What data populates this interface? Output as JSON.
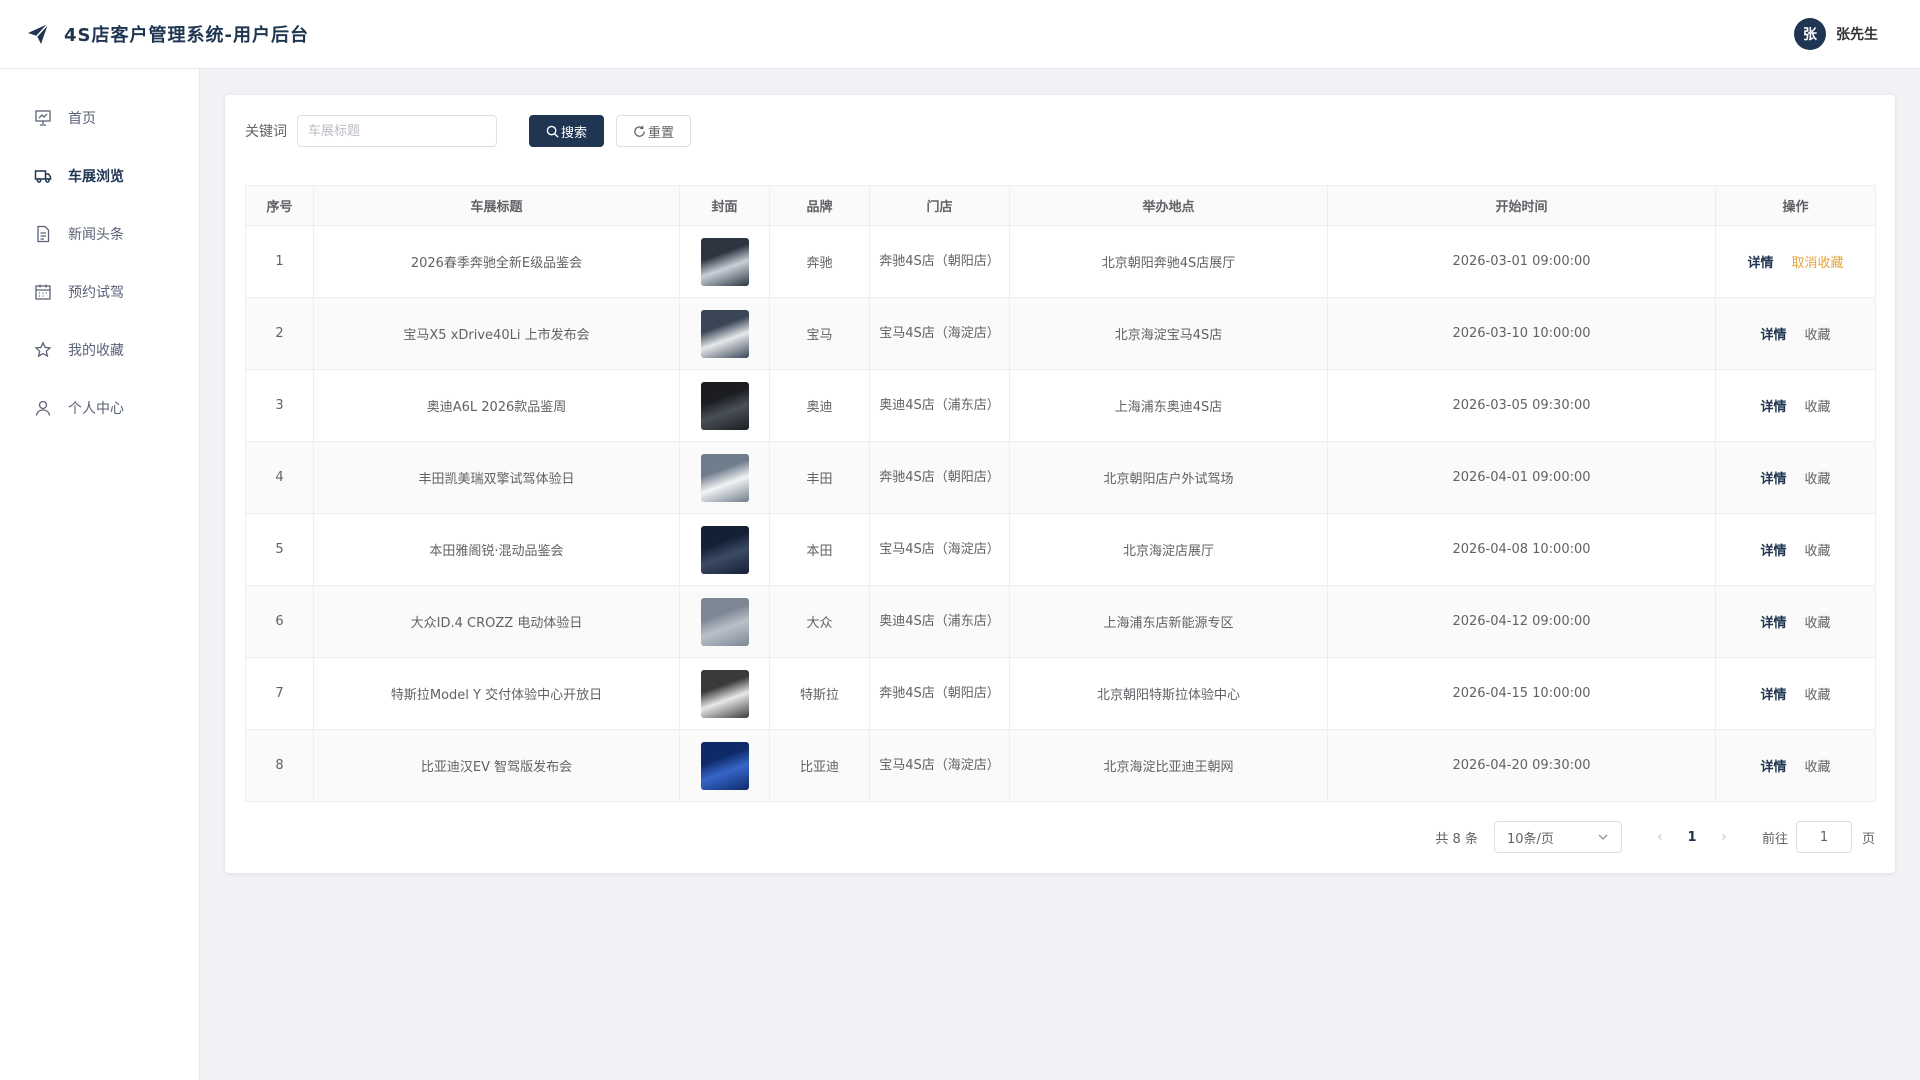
{
  "app": {
    "title": "4S店客户管理系统-用户后台",
    "user_avatar": "张",
    "user_name": "张先生"
  },
  "colors": {
    "primary": "#1f3551",
    "unfavorite": "#e6a23c"
  },
  "sidebar": {
    "items": [
      {
        "label": "首页",
        "icon": "presentation-icon",
        "active": false
      },
      {
        "label": "车展浏览",
        "icon": "truck-icon",
        "active": true
      },
      {
        "label": "新闻头条",
        "icon": "document-icon",
        "active": false
      },
      {
        "label": "预约试驾",
        "icon": "calendar-icon",
        "active": false
      },
      {
        "label": "我的收藏",
        "icon": "star-icon",
        "active": false
      },
      {
        "label": "个人中心",
        "icon": "user-icon",
        "active": false
      }
    ]
  },
  "search": {
    "label": "关键词",
    "placeholder": "车展标题",
    "value": "",
    "search_label": "搜索",
    "reset_label": "重置"
  },
  "table": {
    "headers": [
      "序号",
      "车展标题",
      "封面",
      "品牌",
      "门店",
      "举办地点",
      "开始时间",
      "操作"
    ],
    "rows": [
      {
        "no": "1",
        "title": "2026春季奔驰全新E级品鉴会",
        "brand": "奔驰",
        "store": "奔驰4S店（朝阳店）",
        "location": "北京朝阳奔驰4S店展厅",
        "start": "2026-03-01 09:00:00",
        "detail": "详情",
        "fav": "取消收藏",
        "favorited": true
      },
      {
        "no": "2",
        "title": "宝马X5 xDrive40Li 上市发布会",
        "brand": "宝马",
        "store": "宝马4S店（海淀店）",
        "location": "北京海淀宝马4S店",
        "start": "2026-03-10 10:00:00",
        "detail": "详情",
        "fav": "收藏",
        "favorited": false
      },
      {
        "no": "3",
        "title": "奥迪A6L 2026款品鉴周",
        "brand": "奥迪",
        "store": "奥迪4S店（浦东店）",
        "location": "上海浦东奥迪4S店",
        "start": "2026-03-05 09:30:00",
        "detail": "详情",
        "fav": "收藏",
        "favorited": false
      },
      {
        "no": "4",
        "title": "丰田凯美瑞双擎试驾体验日",
        "brand": "丰田",
        "store": "奔驰4S店（朝阳店）",
        "location": "北京朝阳店户外试驾场",
        "start": "2026-04-01 09:00:00",
        "detail": "详情",
        "fav": "收藏",
        "favorited": false
      },
      {
        "no": "5",
        "title": "本田雅阁锐·混动品鉴会",
        "brand": "本田",
        "store": "宝马4S店（海淀店）",
        "location": "北京海淀店展厅",
        "start": "2026-04-08 10:00:00",
        "detail": "详情",
        "fav": "收藏",
        "favorited": false
      },
      {
        "no": "6",
        "title": "大众ID.4 CROZZ 电动体验日",
        "brand": "大众",
        "store": "奥迪4S店（浦东店）",
        "location": "上海浦东店新能源专区",
        "start": "2026-04-12 09:00:00",
        "detail": "详情",
        "fav": "收藏",
        "favorited": false
      },
      {
        "no": "7",
        "title": "特斯拉Model Y 交付体验中心开放日",
        "brand": "特斯拉",
        "store": "奔驰4S店（朝阳店）",
        "location": "北京朝阳特斯拉体验中心",
        "start": "2026-04-15 10:00:00",
        "detail": "详情",
        "fav": "收藏",
        "favorited": false
      },
      {
        "no": "8",
        "title": "比亚迪汉EV 智驾版发布会",
        "brand": "比亚迪",
        "store": "宝马4S店（海淀店）",
        "location": "北京海淀比亚迪王朝网",
        "start": "2026-04-20 09:30:00",
        "detail": "详情",
        "fav": "收藏",
        "favorited": false
      }
    ]
  },
  "pagination": {
    "total": "共 8 条",
    "page_size": "10条/页",
    "prev": "‹",
    "current": "1",
    "next": "›",
    "goto_label": "前往",
    "goto_value": "1",
    "page_unit": "页"
  }
}
